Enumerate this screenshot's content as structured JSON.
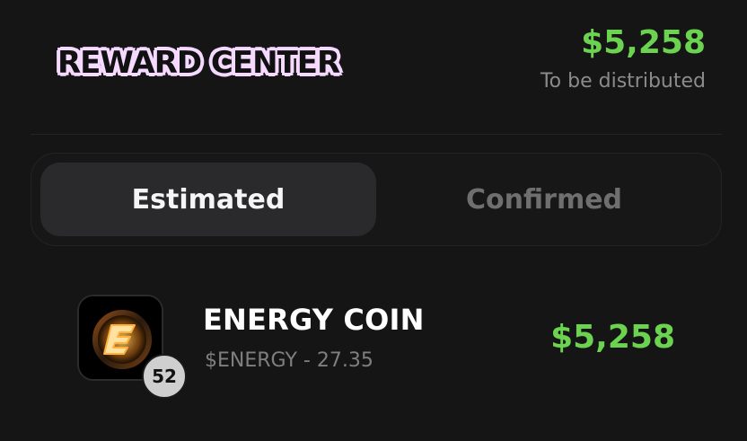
{
  "header": {
    "title": "REWARD CENTER",
    "amount": "$5,258",
    "subtitle": "To be distributed"
  },
  "tabs": [
    {
      "label": "Estimated",
      "active": true
    },
    {
      "label": "Confirmed",
      "active": false
    }
  ],
  "coins": [
    {
      "name": "ENERGY COIN",
      "subtitle": "$ENERGY - 27.35",
      "amount": "$5,258",
      "badge": "52",
      "icon": "energy-coin-icon"
    }
  ],
  "colors": {
    "background": "#151515",
    "accent_green": "#6bd34f",
    "title_outline": "#f6d9ff"
  }
}
